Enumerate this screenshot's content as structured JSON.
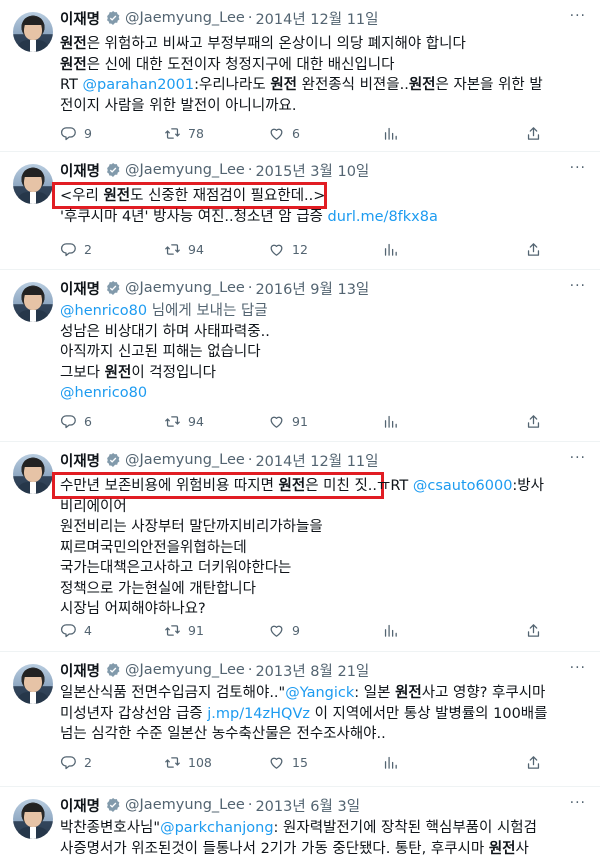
{
  "tweets": [
    {
      "name": "이재명",
      "handle": "@Jaemyung_Lee",
      "dot": "·",
      "date": "2014년 12월 11일",
      "more": "···",
      "lines": [
        [
          {
            "t": "원전",
            "s": "b"
          },
          {
            "t": "은 위험하고 비싸고 부정부패의 온상이니 의당 폐지해야 합니다"
          }
        ],
        [
          {
            "t": "원전",
            "s": "b"
          },
          {
            "t": "은 신에 대한 도전이자 청정지구에 대한 배신입니다"
          }
        ],
        [
          {
            "t": "RT "
          },
          {
            "t": "@parahan2001",
            "s": "link"
          },
          {
            "t": ":우리나라도 "
          },
          {
            "t": "원전",
            "s": "b"
          },
          {
            "t": " 완전종식 비젼을.."
          },
          {
            "t": "원전",
            "s": "b"
          },
          {
            "t": "은 자본을 위한 발"
          }
        ],
        [
          {
            "t": "전이지 사람을 위한 발전이 아니니까요."
          }
        ]
      ],
      "replies": "9",
      "retweets": "78",
      "likes": "6"
    },
    {
      "name": "이재명",
      "handle": "@Jaemyung_Lee",
      "dot": "·",
      "date": "2015년 3월 10일",
      "more": "···",
      "lines": [
        [
          {
            "t": "<우리 "
          },
          {
            "t": "원전",
            "s": "b"
          },
          {
            "t": "도 신중한 재점검이 필요한데..>"
          }
        ],
        [
          {
            "t": "'후쿠시마 4년' 방사능 여진..청소년 암 급증  "
          },
          {
            "t": "durl.me/8fkx8a",
            "s": "link"
          }
        ]
      ],
      "replies": "2",
      "retweets": "94",
      "likes": "12"
    },
    {
      "name": "이재명",
      "handle": "@Jaemyung_Lee",
      "dot": "·",
      "date": "2016년 9월 13일",
      "more": "···",
      "lines": [
        [
          {
            "t": "@henrico80",
            "s": "link"
          },
          {
            "t": " 님에게 보내는 답글",
            "s": "gray"
          }
        ],
        [
          {
            "t": "성남은 비상대기 하며 사태파력중.."
          }
        ],
        [
          {
            "t": "아직까지 신고된 피해는 없습니다"
          }
        ],
        [
          {
            "t": "그보다 "
          },
          {
            "t": "원전",
            "s": "b"
          },
          {
            "t": "이 걱정입니다"
          }
        ],
        [
          {
            "t": "@henrico80",
            "s": "link"
          }
        ]
      ],
      "replies": "6",
      "retweets": "94",
      "likes": "91"
    },
    {
      "name": "이재명",
      "handle": "@Jaemyung_Lee",
      "dot": "·",
      "date": "2014년 12월 11일",
      "more": "···",
      "lines": [
        [
          {
            "t": "수만년 보존비용에 위험비용 따지면 "
          },
          {
            "t": "원전",
            "s": "b"
          },
          {
            "t": "은 미친 짓..ㅠRT "
          },
          {
            "t": "@csauto6000",
            "s": "link"
          },
          {
            "t": ":방사"
          }
        ],
        [
          {
            "t": "비리에이어"
          }
        ],
        [
          {
            "t": "원전비리는 사장부터 말단까지비리가하늘을"
          }
        ],
        [
          {
            "t": "찌르며국민의안전을위협하는데"
          }
        ],
        [
          {
            "t": "국가는대책은고사하고 더키워야한다는"
          }
        ],
        [
          {
            "t": "정책으로 가는현실에 개탄합니다"
          }
        ],
        [
          {
            "t": "시장님 어찌해야하나요?"
          }
        ]
      ],
      "replies": "4",
      "retweets": "91",
      "likes": "9"
    },
    {
      "name": "이재명",
      "handle": "@Jaemyung_Lee",
      "dot": "·",
      "date": "2013년 8월 21일",
      "more": "···",
      "lines": [
        [
          {
            "t": "일본산식품 전면수입금지 검토해야..\""
          },
          {
            "t": "@Yangick",
            "s": "link"
          },
          {
            "t": ": 일본 "
          },
          {
            "t": "원전",
            "s": "b"
          },
          {
            "t": "사고 영향? 후쿠시마"
          }
        ],
        [
          {
            "t": "미성년자 갑상선암 급증 "
          },
          {
            "t": "j.mp/14zHQVz",
            "s": "link"
          },
          {
            "t": " 이 지역에서만 통상 발병률의 100배를"
          }
        ],
        [
          {
            "t": "넘는 심각한 수준 일본산 농수축산물은 전수조사해야.."
          }
        ]
      ],
      "replies": "2",
      "retweets": "108",
      "likes": "15"
    },
    {
      "name": "이재명",
      "handle": "@Jaemyung_Lee",
      "dot": "·",
      "date": "2013년 6월 3일",
      "more": "···",
      "lines": [
        [
          {
            "t": "박찬종변호사님\""
          },
          {
            "t": "@parkchanjong",
            "s": "link"
          },
          {
            "t": ": 원자력발전기에 장착된 핵심부품이 시험검"
          }
        ],
        [
          {
            "t": "사증명서가 위조된것이 들통나서 2기가 가동 중단됐다. 통탄, 후쿠시마 "
          },
          {
            "t": "원전",
            "s": "b"
          },
          {
            "t": "사"
          }
        ]
      ]
    }
  ]
}
